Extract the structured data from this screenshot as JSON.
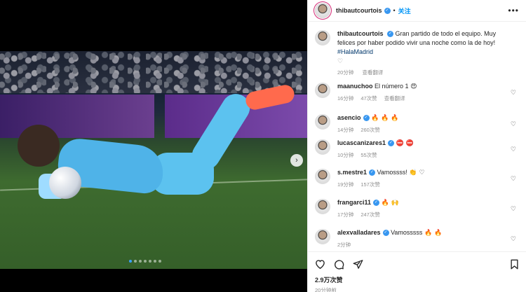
{
  "post": {
    "author": "thibautcourtois",
    "follow_label": "关注",
    "caption_text": "Gran partido de todo el equipo. Muy felices por haber podido vivir una noche como la de hoy!",
    "caption_hashtag": "#HalaMadrid",
    "caption_time": "20分钟",
    "caption_translate": "查看翻译",
    "likes": "2.9万次赞",
    "time": "20分钟前"
  },
  "media": {
    "carousel_total": 7,
    "carousel_active": 1
  },
  "comments": [
    {
      "user": "maanuchoo",
      "text": "El número 1",
      "emoji": "😍",
      "time": "16分钟",
      "likes": "47次赞",
      "translate": "查看翻译"
    },
    {
      "user": "asencio",
      "verified": true,
      "text": "",
      "emoji": "🔥 🔥 🔥",
      "time": "14分钟",
      "likes": "260次赞"
    },
    {
      "user": "lucascanizares1",
      "verified": true,
      "text": "",
      "emoji": "⛔ ⛔",
      "time": "10分钟",
      "likes": "55次赞"
    },
    {
      "user": "s.mestre1",
      "verified": true,
      "text": "Vamossss!",
      "emoji": "👏 ♡",
      "time": "19分钟",
      "likes": "157次赞"
    },
    {
      "user": "frangarci11",
      "verified": true,
      "text": "",
      "emoji": "🔥 🙌",
      "time": "17分钟",
      "likes": "247次赞"
    },
    {
      "user": "alexvalladares",
      "verified": true,
      "text": "Vamosssss",
      "emoji": "🔥 🔥",
      "time": "2分钟",
      "likes": ""
    }
  ],
  "colors": {
    "link_blue": "#0095f6",
    "verified_blue": "#3897f0",
    "meta_gray": "#8e8e8e"
  },
  "icons": [
    "heart-icon",
    "comment-icon",
    "share-icon",
    "bookmark-icon",
    "more-icon",
    "verified-icon",
    "chevron-right-icon"
  ]
}
